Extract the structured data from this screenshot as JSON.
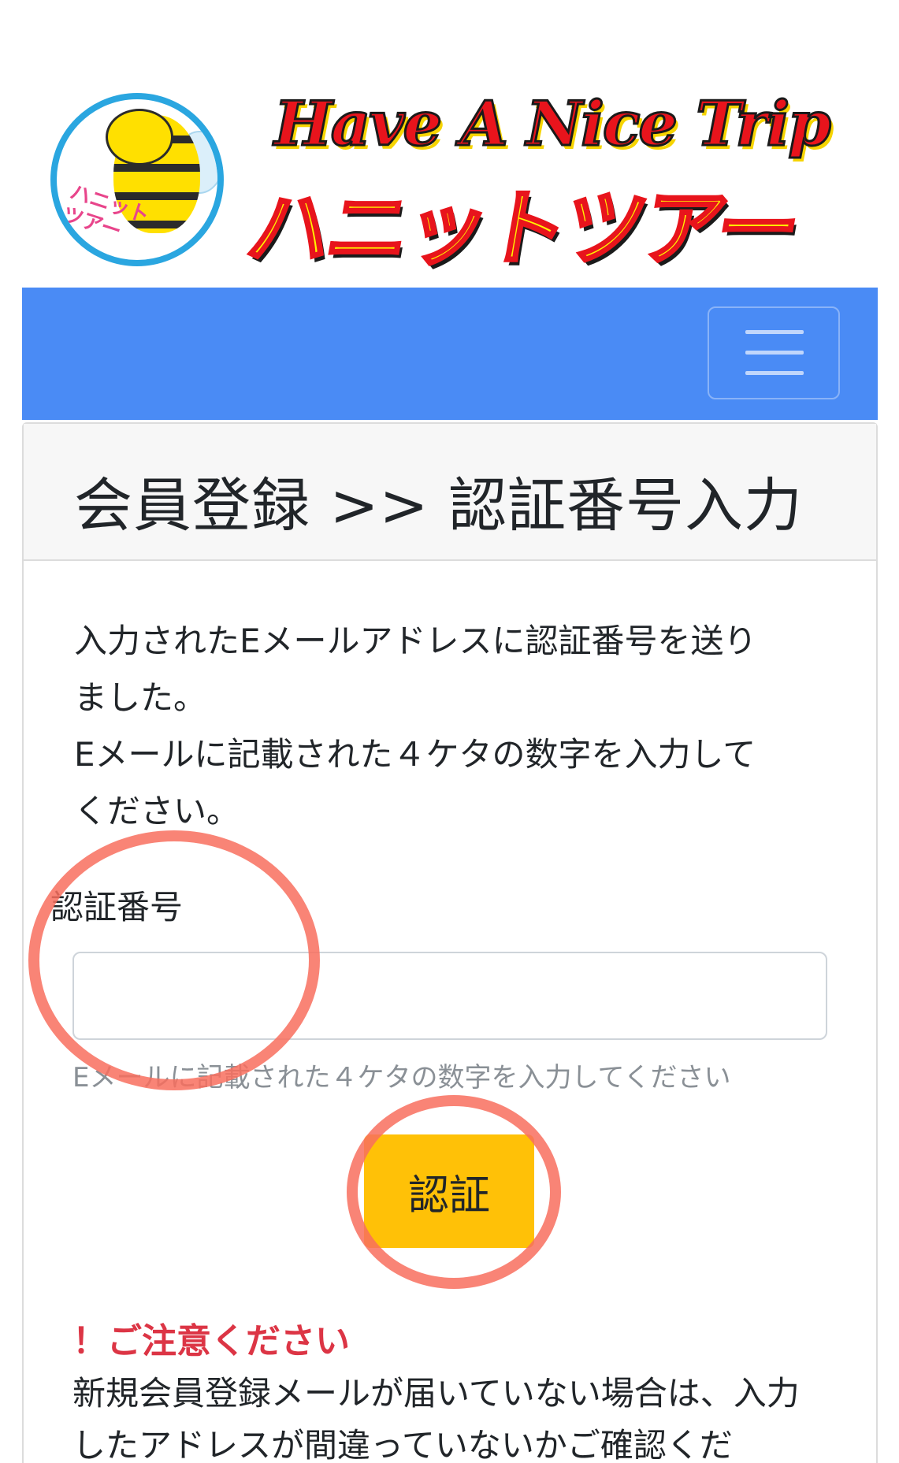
{
  "header": {
    "logo_circle_text": "ハニット\nツアー",
    "logo_title_en": "Have A Nice Trip",
    "logo_title_jp": "ハニットツアー"
  },
  "navbar": {
    "menu_icon": "hamburger-menu-icon"
  },
  "card": {
    "title": "会員登録 >> 認証番号入力",
    "intro": "入力されたEメールアドレスに認証番号を送り\nました。\nEメールに記載された４ケタの数字を入力して\nください。",
    "field_label": "認証番号",
    "code_value": "",
    "help_text": "Eメールに記載された４ケタの数字を入力してください",
    "verify_button": "認証",
    "caution_title": "！ご注意ください",
    "caution_text": "新規会員登録メールが届いていない場合は、入力したアドレスが間違っていないかご確認くだ"
  },
  "colors": {
    "navbar": "#4a8bf5",
    "button": "#ffc107",
    "caution": "#dc3545",
    "annotation": "#f86e5e"
  }
}
